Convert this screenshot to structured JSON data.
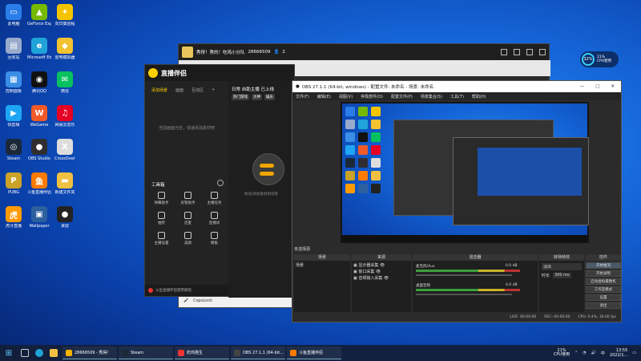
{
  "desktop": {
    "icons": [
      {
        "label": "此电脑",
        "color": "#2b7de9",
        "glyph": "▭"
      },
      {
        "label": "GeForce Experience",
        "color": "#76b900",
        "glyph": "▲"
      },
      {
        "label": "向日葵远程",
        "color": "#f5c400",
        "glyph": "✦"
      },
      {
        "label": "回收站",
        "color": "#9ac",
        "glyph": "▤"
      },
      {
        "label": "Microsoft Edge",
        "color": "#1fa3d9",
        "glyph": "e"
      },
      {
        "label": "雷电模拟器",
        "color": "#f2c230",
        "glyph": "◆"
      },
      {
        "label": "控制面板",
        "color": "#3a8ee6",
        "glyph": "▦"
      },
      {
        "label": "腾讯QQ",
        "color": "#111",
        "glyph": "◉"
      },
      {
        "label": "微信",
        "color": "#07c160",
        "glyph": "✉"
      },
      {
        "label": "快剪辑",
        "color": "#1ea6f5",
        "glyph": "▶"
      },
      {
        "label": "WeGame",
        "color": "#f05a28",
        "glyph": "W"
      },
      {
        "label": "网易云音乐",
        "color": "#e60026",
        "glyph": "♫"
      },
      {
        "label": "Steam",
        "color": "#1b2838",
        "glyph": "◎"
      },
      {
        "label": "OBS Studio",
        "color": "#302e31",
        "glyph": "●"
      },
      {
        "label": "CrossOver",
        "color": "#ddd",
        "glyph": "X"
      },
      {
        "label": "PUBG",
        "color": "#c9a227",
        "glyph": "P"
      },
      {
        "label": "斗鱼直播伴侣",
        "color": "#ff7a00",
        "glyph": "鱼"
      },
      {
        "label": "新建文件夹",
        "color": "#f0c040",
        "glyph": "▬"
      },
      {
        "label": "虎牙直播",
        "color": "#ff9a00",
        "glyph": "虎"
      },
      {
        "label": "Wallpaper",
        "color": "#2c5f9e",
        "glyph": "▣"
      },
      {
        "label": "录屏",
        "color": "#222",
        "glyph": "●"
      }
    ]
  },
  "back_window": {
    "title": "秀得！秀的！吃鸡小分队",
    "room_id": "28666509",
    "viewers": "2"
  },
  "zhibo_window": {
    "app_name": "直播伴侣",
    "tabs": [
      "添加场景",
      "画面",
      "互动区",
      "+"
    ],
    "hint": "当前画面为空，快速添加素材吧",
    "tools_title": "工具箱",
    "tools": [
      "弹幕助手",
      "房管助手",
      "主播任务",
      "抽奖",
      "连麦",
      "直播间",
      "主播设置",
      "美颜",
      "模板"
    ],
    "right_header": "日常 自助主播 已上线",
    "chips": [
      "热门游戏",
      "大神",
      "娱乐"
    ],
    "right_hint": "拖动/添加素材到场景",
    "footer": "斗鱼直播伴侣使用教程"
  },
  "obs_window": {
    "title": "OBS 27.1.1 (64-bit, windows) - 配置文件: 未命名 - 场景: 未命名",
    "menu": [
      "文件(F)",
      "编辑(E)",
      "视图(V)",
      "停靠部件(D)",
      "配置文件(P)",
      "场景集合(S)",
      "工具(T)",
      "帮助(H)"
    ],
    "docks": {
      "scenes_title": "场景",
      "scene_item": "场景",
      "sources_title": "来源",
      "sources": [
        "显示器采集",
        "窗口采集",
        "音频输入采集"
      ],
      "mixer_title": "混音器",
      "mixer": [
        {
          "name": "麦克风/Aux",
          "db": "0.0 dB"
        },
        {
          "name": "桌面音频",
          "db": "0.0 dB"
        }
      ],
      "transition_title": "转场特效",
      "transition": "淡出",
      "duration_label": "时长",
      "duration": "300 ms",
      "controls_title": "控件",
      "controls": [
        "开始推流",
        "开始录制",
        "启动虚拟摄像机",
        "工作室模式",
        "设置",
        "退出"
      ]
    },
    "status": {
      "live": "LIVE: 00:00:00",
      "rec": "REC: 00:00:00",
      "cpu": "CPU: 0.4%, 30.00 fps"
    },
    "active_selection": "未选择源"
  },
  "perf_widget": {
    "percent": "32%",
    "cpu_pct": "21%",
    "cpu_label": "CPU使用"
  },
  "taskbar": {
    "apps": [
      {
        "label": "28666509 - 秀得！",
        "color": "#f5b400"
      },
      {
        "label": "Steam",
        "color": "#1b2838"
      },
      {
        "label": "奶鸡搭生",
        "color": "#e33"
      },
      {
        "label": "OBS 27.1.1 (64-bit...",
        "color": "#444"
      },
      {
        "label": "斗鱼直播伴侣",
        "color": "#ff7a00"
      }
    ],
    "cpu": "21%",
    "cpu_label": "CPU使用",
    "time": "13:55",
    "date": "2022/1..."
  }
}
